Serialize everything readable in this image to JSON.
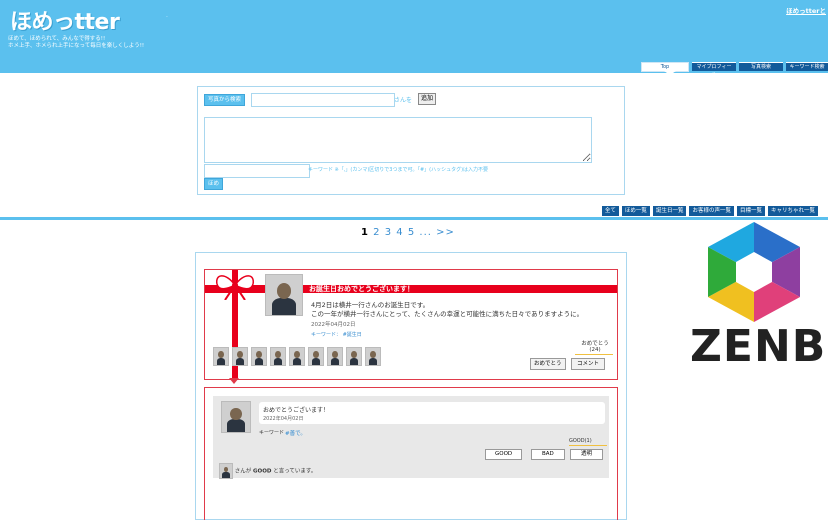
{
  "header": {
    "logo": "ほめっtter",
    "tagline_1": "ほめて、ほめられて、みんなで得する!!",
    "tagline_2": "ホメ上手、ホメられ上手になって毎日を楽しくしよう!!",
    "top_link": "ほめっtterと",
    "dot": "·",
    "bg_color": "#5bc0ee"
  },
  "tabs": [
    {
      "label": "Top",
      "active": true
    },
    {
      "label": "マイプロフィール"
    },
    {
      "label": "写真検索"
    },
    {
      "label": "キーワード検索"
    }
  ],
  "form": {
    "photo_button": "写真から検索",
    "san_label": "さんを",
    "add_button": "追加",
    "keyword_hint": "キーワード ※「,」(カンマ)区切りで3つまで可。「#」(ハッシュタグ)は入力不要",
    "praise_button": "ほめ"
  },
  "filters": [
    "全て",
    "ほめ一覧",
    "誕生日一覧",
    "お客様の声一覧",
    "目標一覧",
    "キャリちゃれ一覧"
  ],
  "pager": {
    "current": "1",
    "pages": [
      "2",
      "3",
      "4",
      "5"
    ],
    "more": "... >>"
  },
  "birthday_card": {
    "title": "お誕生日おめでとうございます！",
    "line1": "4月2日は横井一行さんのお誕生日です。",
    "line2": "この一年が横井一行さんにとって、たくさんの幸運と可能性に満ちた日々でありますように。",
    "date": "2022年04月02日",
    "keyword": "キーワード：  #誕生日",
    "cong_label": "おめでとう",
    "cong_count": "(24)",
    "cong_button": "おめでとう",
    "comment_button": "コメント"
  },
  "comment": {
    "text": "おめでとうございます！",
    "date": "2022年04月02日",
    "keyword_label": "キーワード",
    "keyword": "#善で。",
    "good_count": "GOOD(1)",
    "good_button": "GOOD",
    "bad_button": "BAD",
    "toumei_button": "透明",
    "says_prefix": "さんが",
    "says_bold": "GOOD",
    "says_suffix": "と言っています。"
  },
  "brand": {
    "text": "ZENB"
  }
}
